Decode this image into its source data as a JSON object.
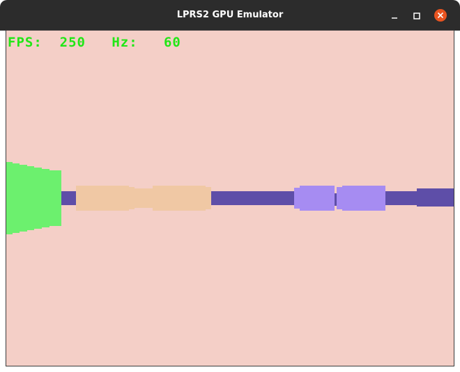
{
  "window": {
    "title": "LPRS2 GPU Emulator",
    "controls": {
      "minimize_icon": "minimize-icon",
      "maximize_icon": "maximize-icon",
      "close_icon": "close-icon"
    }
  },
  "hud": {
    "fps_label": "FPS:",
    "fps_value": "250",
    "hz_label": "Hz:",
    "hz_value": "60"
  },
  "colors": {
    "titlebar": "#2c2c2c",
    "background": "#f4cfc7",
    "hud_text": "#21e616",
    "close_button": "#e95420",
    "road_purple": "#5e4ea8",
    "green_block": "#6cf06e",
    "peach_block": "#f0c8a4",
    "lilac_block": "#a68cf2"
  }
}
